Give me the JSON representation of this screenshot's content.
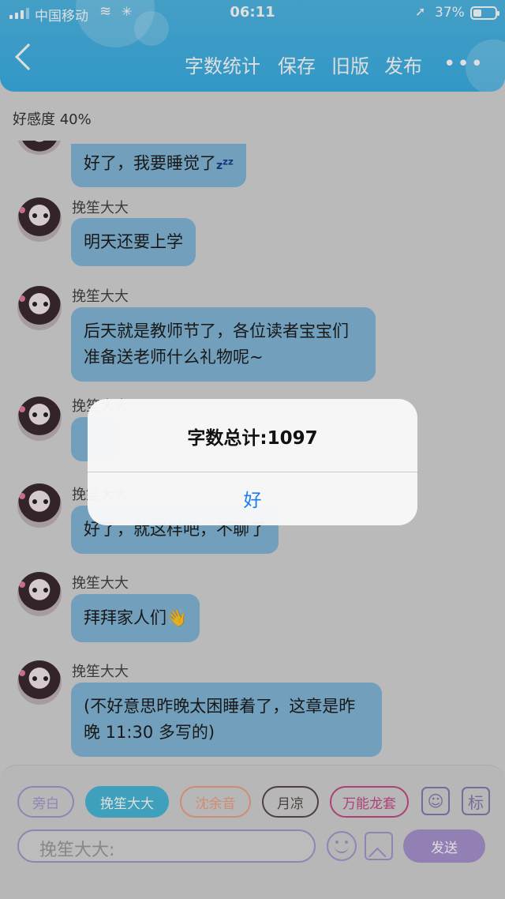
{
  "status_bar": {
    "carrier": "中国移动",
    "time": "06:11",
    "battery": "37%",
    "battery_level": 0.37
  },
  "header": {
    "back_icon": "chevron-left-icon",
    "word_count_label": "字数统计",
    "save_label": "保存",
    "old_version_label": "旧版",
    "publish_label": "发布",
    "more_icon": "more-icon"
  },
  "affinity_label": "好感度 40%",
  "messages": [
    {
      "author": "",
      "text": "好了，我要睡觉了",
      "emoji": "zzz"
    },
    {
      "author": "挽笙大大",
      "text": "明天还要上学"
    },
    {
      "author": "挽笙大大",
      "text": "后天就是教师节了，各位读者宝宝们准备送老师什么礼物呢~"
    },
    {
      "author": "挽笙大大",
      "text": ""
    },
    {
      "author": "挽笙大大",
      "text": "好了，就这样吧，不聊了"
    },
    {
      "author": "挽笙大大",
      "text": "拜拜家人们👋"
    },
    {
      "author": "挽笙大大",
      "text": "(不好意思昨晚太困睡着了，这章是昨晚 11:30 多写的)"
    }
  ],
  "roles": [
    {
      "label": "旁白",
      "color": "#a996cf",
      "selected": false
    },
    {
      "label": "挽笙大大",
      "color": "#48b8d8",
      "selected": true
    },
    {
      "label": "沈余音",
      "color": "#f0a083",
      "selected": false
    },
    {
      "label": "月凉",
      "color": "#5a4a4a",
      "selected": false
    },
    {
      "label": "万能龙套",
      "color": "#c84a8a",
      "selected": false
    }
  ],
  "role_icon": "person-icon",
  "mark_label": "标",
  "input": {
    "placeholder": "挽笙大大:"
  },
  "emoji_icon": "smile-icon",
  "image_icon": "image-icon",
  "send_label": "发送",
  "alert": {
    "message": "字数总计:1097",
    "ok_label": "好"
  },
  "colors": {
    "header": "#3aaee4",
    "bubble": "#82b7d8",
    "accent": "#a892cf",
    "alert_link": "#1b7cf0"
  }
}
